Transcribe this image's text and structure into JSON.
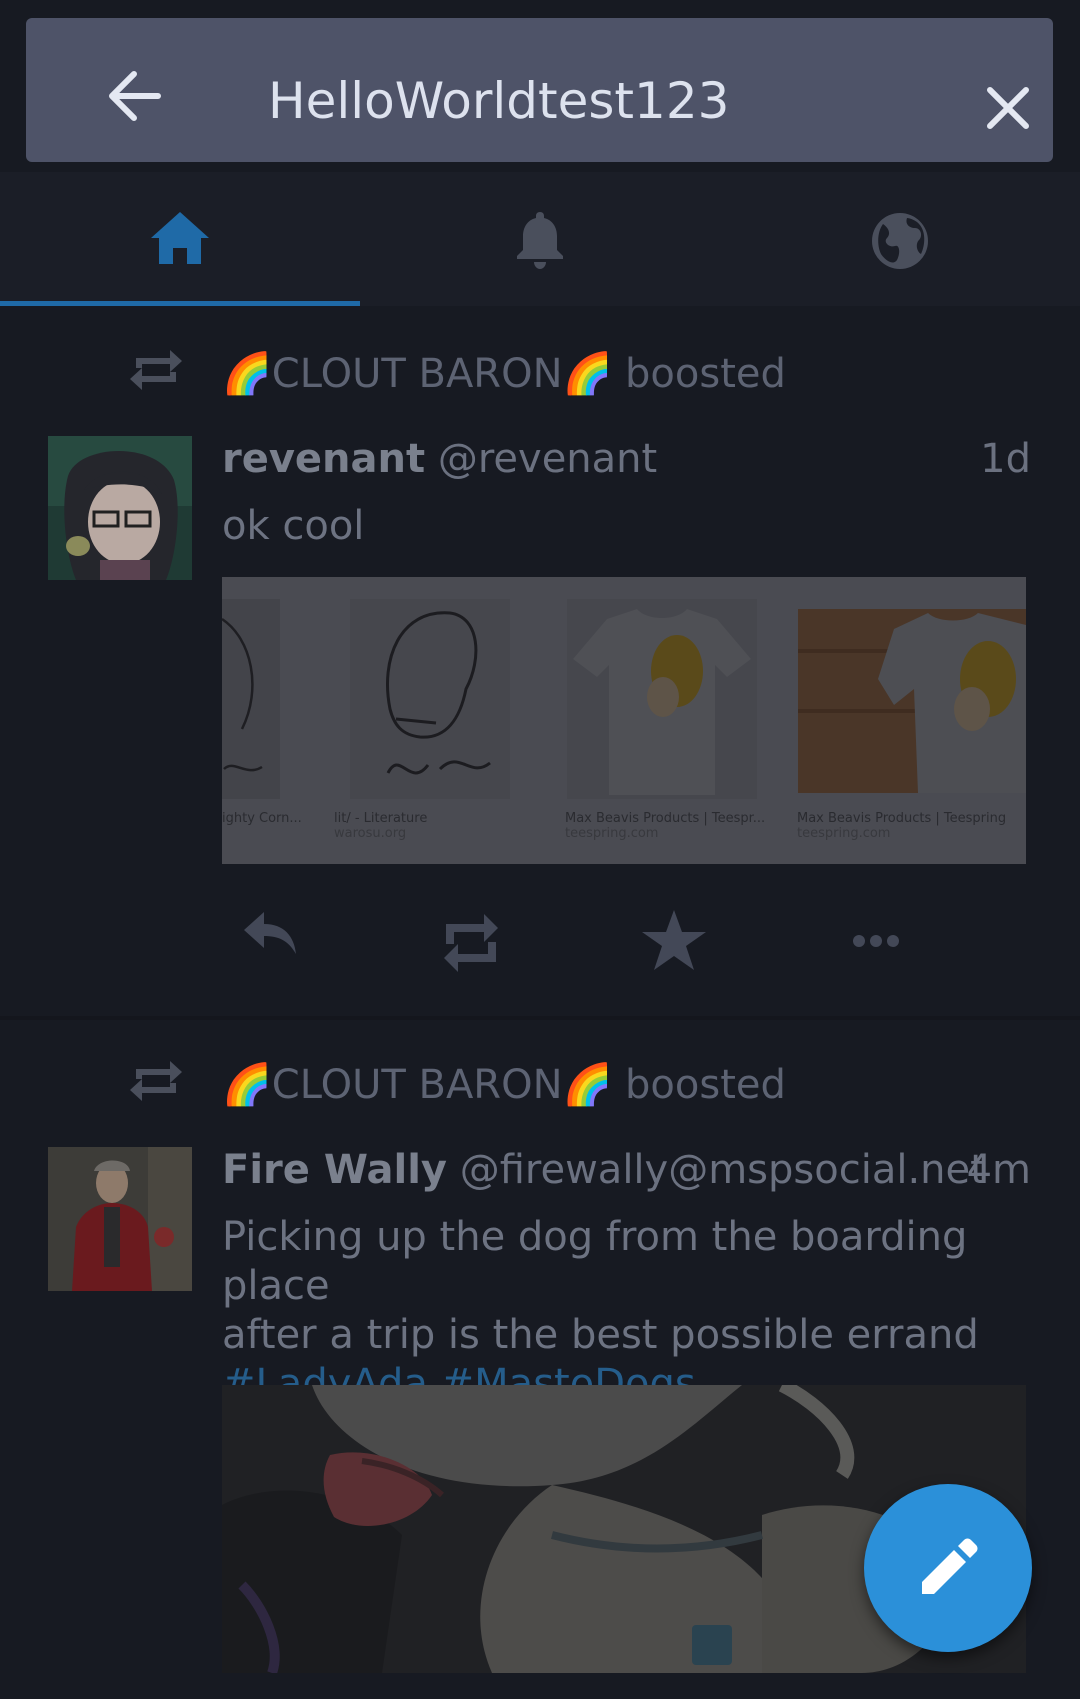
{
  "search": {
    "query": "HelloWorldtest123"
  },
  "tabs": [
    {
      "name": "home",
      "icon": "home-icon",
      "active": true
    },
    {
      "name": "notifications",
      "icon": "bell-icon",
      "active": false
    },
    {
      "name": "federated",
      "icon": "globe-icon",
      "active": false
    }
  ],
  "statuses": [
    {
      "boosted_by": "🌈CLOUT BARON🌈",
      "boost_suffix": "boosted",
      "display_name": "revenant",
      "acct": "@revenant",
      "time": "1d",
      "content": "ok cool",
      "media": {
        "captions": [
          {
            "title": "ighty Corn...",
            "site": ""
          },
          {
            "title": "lit/ - Literature",
            "site": "warosu.org"
          },
          {
            "title": "Max Beavis Products | Teespr...",
            "site": "teespring.com"
          },
          {
            "title": "Max Beavis Products | Teespring",
            "site": "teespring.com"
          }
        ]
      }
    },
    {
      "boosted_by": "🌈CLOUT BARON🌈",
      "boost_suffix": "boosted",
      "display_name": "Fire Wally",
      "acct": "@firewally@mspsocial.net",
      "time": "4m",
      "content_line1": "Picking up the dog from the boarding place",
      "content_line2": "after a trip is the best possible errand",
      "hashtags": [
        "#LadyAda",
        "#MastoDogs"
      ]
    }
  ],
  "colors": {
    "accent": "#2b90d9",
    "search_bg": "#4e5368",
    "page_bg": "#171a22"
  }
}
